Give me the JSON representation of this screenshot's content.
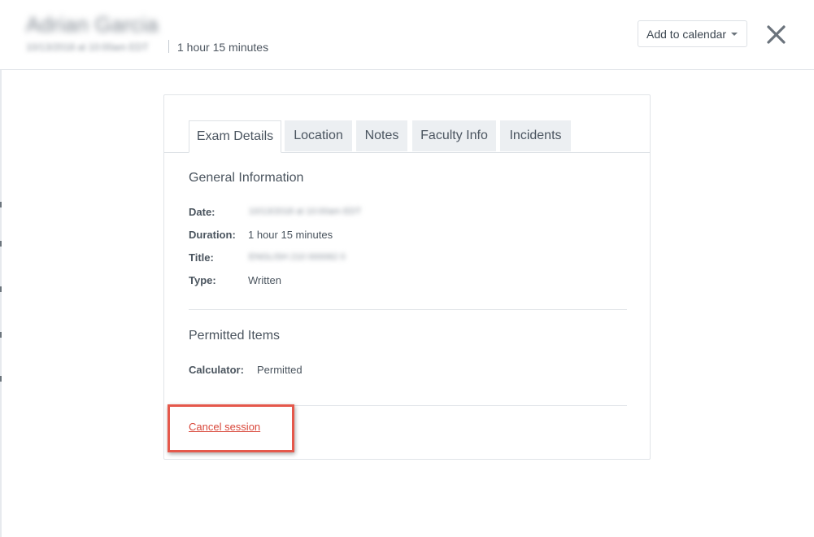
{
  "header": {
    "name": "Adrian Garcia",
    "date": "10/13/2018 at 10:00am EDT",
    "duration": "1 hour 15 minutes",
    "calendar_button_label": "Add to calendar",
    "close_icon": "close-icon"
  },
  "tabs": [
    {
      "label": "Exam Details",
      "active": true
    },
    {
      "label": "Location",
      "active": false
    },
    {
      "label": "Notes",
      "active": false
    },
    {
      "label": "Faculty Info",
      "active": false
    },
    {
      "label": "Incidents",
      "active": false
    }
  ],
  "general": {
    "title": "General Information",
    "fields": [
      {
        "label": "Date:",
        "value": "10/13/2018 at 10:00am EDT"
      },
      {
        "label": "Duration:",
        "value": "1 hour 15 minutes"
      },
      {
        "label": "Title:",
        "value": "ENGLISH 210 000062 0"
      },
      {
        "label": "Type:",
        "value": "Written"
      }
    ]
  },
  "permitted": {
    "title": "Permitted Items",
    "fields": [
      {
        "label": "Calculator:",
        "value": "Permitted"
      }
    ]
  },
  "actions": {
    "cancel_label": "Cancel session"
  },
  "colors": {
    "accent": "#2f74c0",
    "danger": "#d9483b",
    "highlight": "#e5584b"
  }
}
